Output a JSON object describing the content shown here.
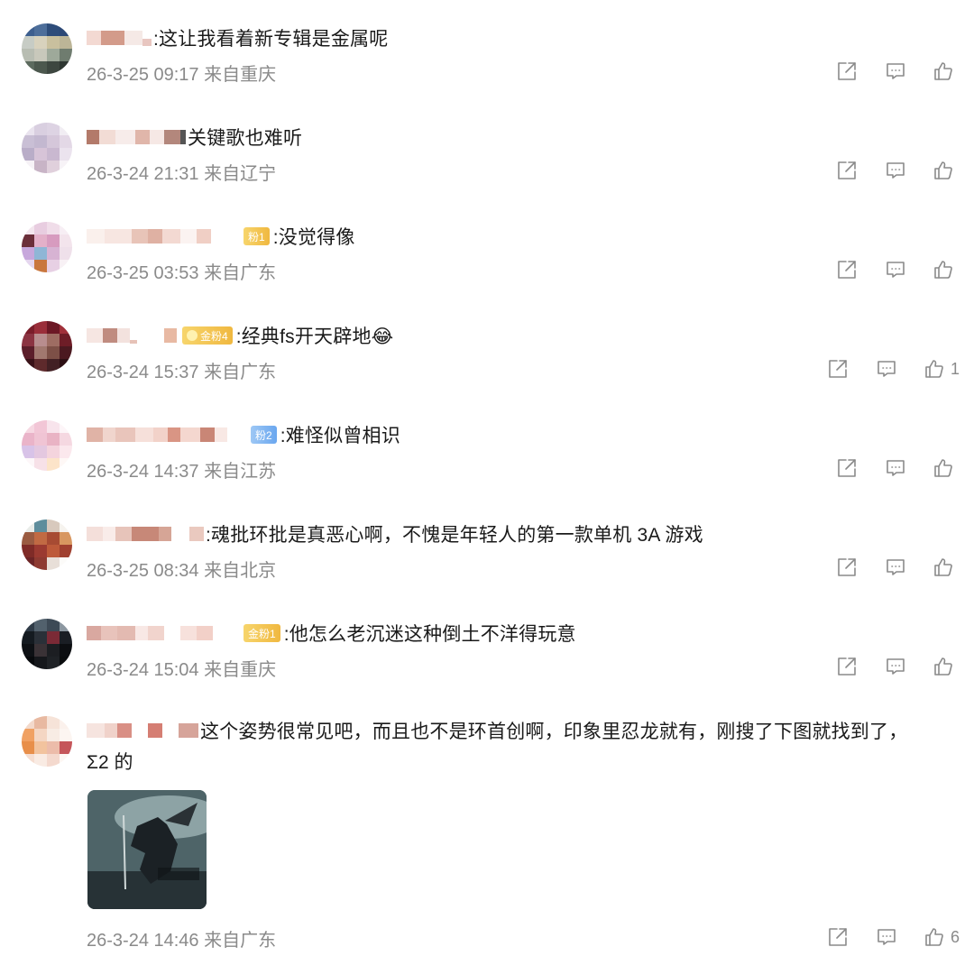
{
  "comments": [
    {
      "text": ":这让我看着新专辑是金属呢",
      "meta": "26-3-25 09:17 来自重庆",
      "likes": ""
    },
    {
      "text": "关键歌也难听",
      "meta": "26-3-24 21:31 来自辽宁",
      "likes": ""
    },
    {
      "badge": "粉1",
      "text": ":没觉得像",
      "meta": "26-3-25 03:53 来自广东",
      "likes": ""
    },
    {
      "badge": "金粉4",
      "text": ":经典fs开天辟地😂",
      "meta": "26-3-24 15:37 来自广东",
      "likes": "1"
    },
    {
      "badge": "粉2",
      "text": ":难怪似曾相识",
      "meta": "26-3-24 14:37 来自江苏",
      "likes": ""
    },
    {
      "text": ":魂批环批是真恶心啊，不愧是年轻人的第一款单机 3A 游戏",
      "meta": "26-3-25 08:34 来自北京",
      "likes": ""
    },
    {
      "badge": "金粉1",
      "text": ":他怎么老沉迷这种倒土不洋得玩意",
      "meta": "26-3-24 15:04 来自重庆",
      "likes": ""
    },
    {
      "text": "这个姿势很常见吧，而且也不是环首创啊，印象里忍龙就有，刚搜了下图就找到了，",
      "text2": "Σ2 的",
      "meta": "26-3-24 14:46 来自广东",
      "likes": "6"
    }
  ],
  "icons": {
    "share": "share-icon",
    "comment": "comment-icon",
    "like": "like-icon"
  },
  "colors": {
    "meta": "#8a8a8a",
    "text": "#1a1a1a",
    "badge_gold": "#f0b840",
    "badge_blue": "#6aa7ef"
  }
}
